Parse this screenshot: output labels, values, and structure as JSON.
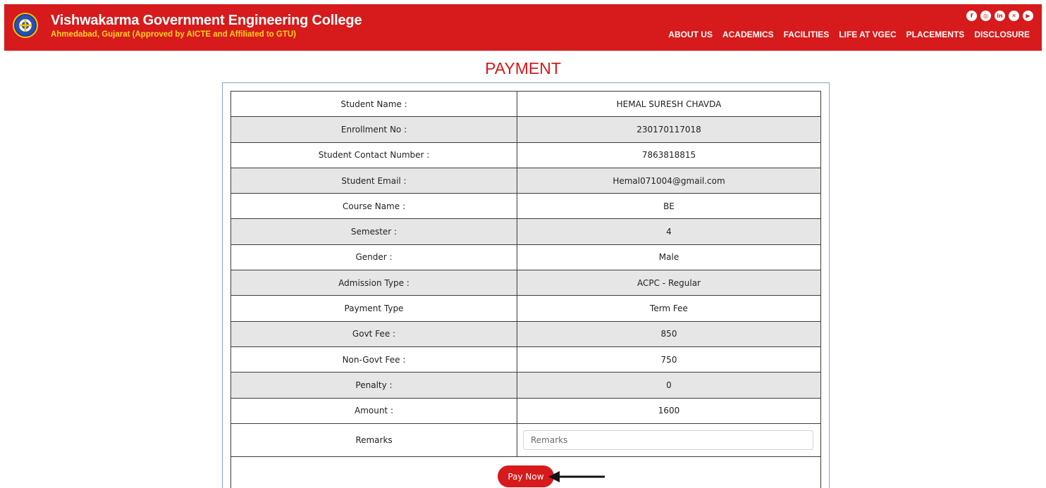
{
  "header": {
    "college_name": "Vishwakarma Government Engineering College",
    "college_sub": "Ahmedabad, Gujarat (Approved by AICTE and Affiliated to GTU)",
    "logo_icon": "college-logo",
    "social_icons": [
      "facebook-icon",
      "instagram-icon",
      "linkedin-icon",
      "x-icon",
      "youtube-icon"
    ],
    "nav": [
      "ABOUT US",
      "ACADEMICS",
      "FACILITIES",
      "LIFE AT VGEC",
      "PLACEMENTS",
      "DISCLOSURE"
    ],
    "brand_color": "#d71a1b",
    "subtitle_color": "#ffd21f"
  },
  "page_title": "PAYMENT",
  "rows": [
    {
      "label": "Student Name :",
      "value": "HEMAL SURESH CHAVDA"
    },
    {
      "label": "Enrollment No :",
      "value": "230170117018"
    },
    {
      "label": "Student Contact Number :",
      "value": "7863818815"
    },
    {
      "label": "Student Email :",
      "value": "Hemal071004@gmail.com"
    },
    {
      "label": "Course Name :",
      "value": "BE"
    },
    {
      "label": "Semester :",
      "value": "4"
    },
    {
      "label": "Gender :",
      "value": "Male"
    },
    {
      "label": "Admission Type :",
      "value": "ACPC - Regular"
    },
    {
      "label": "Payment Type",
      "value": "Term Fee"
    },
    {
      "label": "Govt Fee :",
      "value": "850"
    },
    {
      "label": "Non-Govt Fee :",
      "value": "750"
    },
    {
      "label": "Penalty :",
      "value": "0"
    },
    {
      "label": "Amount :",
      "value": "1600"
    }
  ],
  "remarks": {
    "label": "Remarks",
    "placeholder": "Remarks",
    "value": ""
  },
  "pay_button": "Pay Now",
  "arrow_icon": "arrow-left-icon"
}
